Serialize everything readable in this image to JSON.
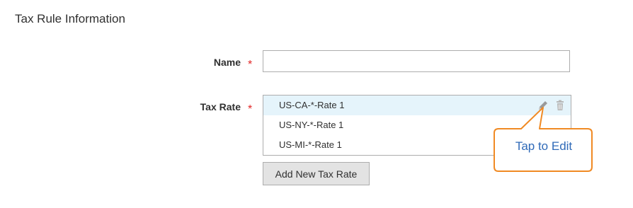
{
  "section": {
    "title": "Tax Rule Information"
  },
  "fields": {
    "name": {
      "label": "Name",
      "required_mark": "*",
      "value": "",
      "placeholder": ""
    },
    "tax_rate": {
      "label": "Tax Rate",
      "required_mark": "*"
    }
  },
  "tax_rates": [
    {
      "label": "US-CA-*-Rate 1",
      "active": true
    },
    {
      "label": "US-NY-*-Rate 1",
      "active": false
    },
    {
      "label": "US-MI-*-Rate 1",
      "active": false
    }
  ],
  "actions": {
    "add_label": "Add New Tax Rate"
  },
  "icons": {
    "edit": "pencil-icon",
    "delete": "trash-icon"
  },
  "tooltip": {
    "text": "Tap to Edit"
  },
  "colors": {
    "required": "#e22626",
    "active_row": "#e5f4fb",
    "tooltip_border": "#f08a24",
    "tooltip_text": "#2f6ab8",
    "button_bg": "#e3e3e3"
  }
}
